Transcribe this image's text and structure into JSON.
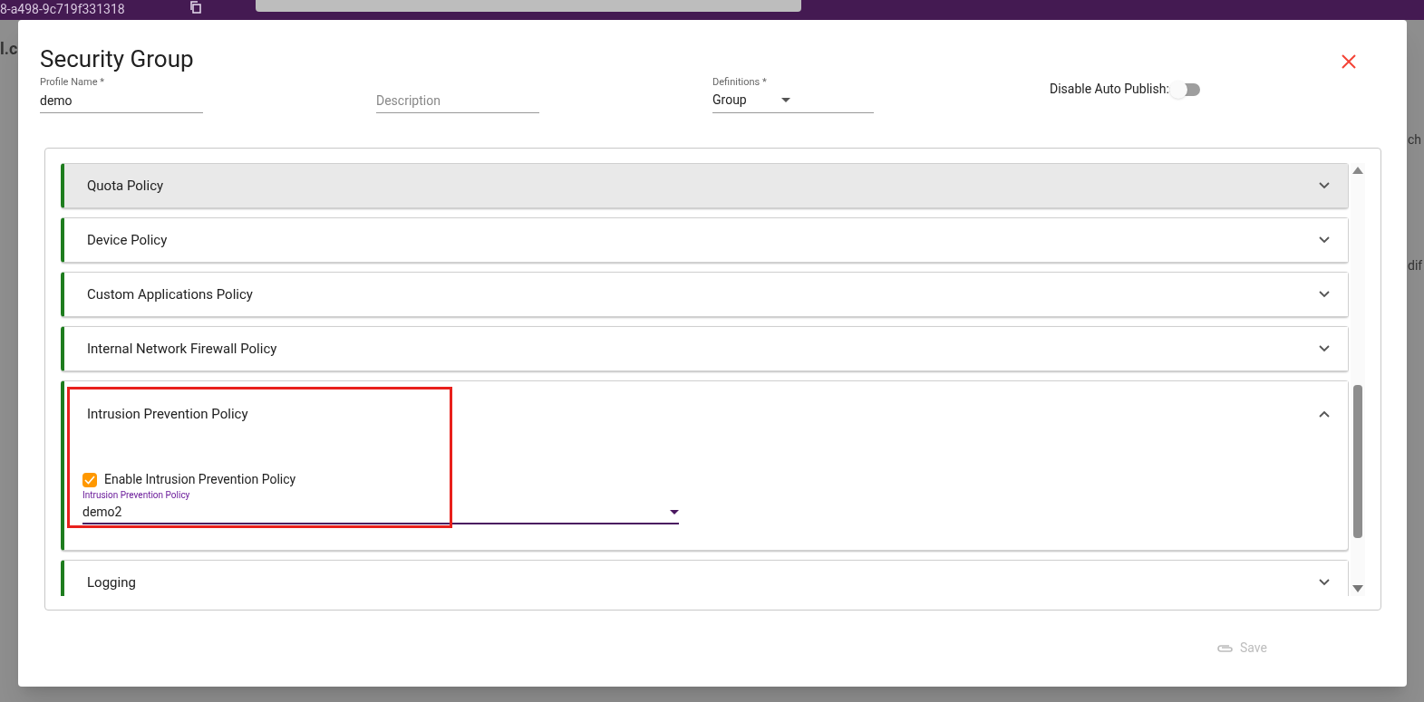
{
  "background": {
    "cluster_id": "8-a498-9c719f331318",
    "fragments": [
      "l.c",
      "ch",
      "dif"
    ]
  },
  "dialog": {
    "title": "Security Group",
    "fields": [
      {
        "kind": "text",
        "label": "Profile Name *",
        "value": "demo"
      },
      {
        "kind": "text",
        "placeholder": "Description"
      },
      {
        "kind": "select",
        "label": "Definitions *",
        "value": "Group"
      }
    ],
    "auto_publish": {
      "label": "Disable Auto Publish:",
      "on": false
    },
    "panels": [
      {
        "title": "Quota Policy",
        "expanded": false,
        "focused": true
      },
      {
        "title": "Device Policy",
        "expanded": false,
        "focused": false
      },
      {
        "title": "Custom Applications Policy",
        "expanded": false,
        "focused": false
      },
      {
        "title": "Internal Network Firewall Policy",
        "expanded": false,
        "focused": false
      },
      {
        "title": "Intrusion Prevention Policy",
        "expanded": true,
        "focused": false,
        "checkbox": {
          "label": "Enable Intrusion Prevention Policy",
          "checked": true
        },
        "select": {
          "label": "Intrusion Prevention Policy",
          "value": "demo2"
        }
      },
      {
        "title": "Logging",
        "expanded": false,
        "focused": false
      }
    ],
    "save": {
      "label": "Save",
      "disabled": true
    }
  }
}
